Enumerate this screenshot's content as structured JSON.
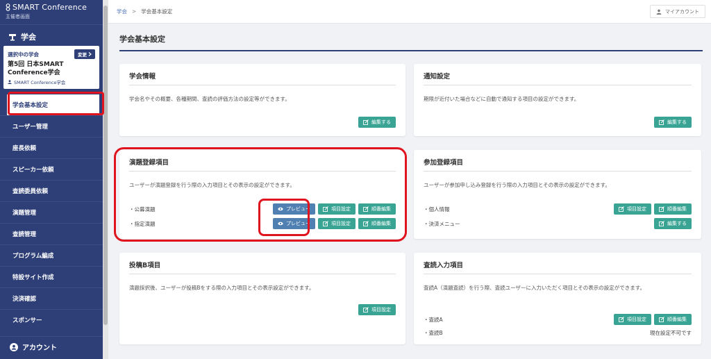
{
  "brand": {
    "name": "SMART Conference",
    "sub": "主催者画面"
  },
  "sidebar": {
    "section_label": "学会",
    "conference": {
      "selected_label": "選択中の学会",
      "change_label": "変更",
      "name": "第5回 日本SMART Conference学会",
      "org": "SMART Conference学会"
    },
    "items": [
      {
        "label": "学会基本設定"
      },
      {
        "label": "ユーザー管理"
      },
      {
        "label": "座長依頼"
      },
      {
        "label": "スピーカー依頼"
      },
      {
        "label": "査読委員依頼"
      },
      {
        "label": "演題管理"
      },
      {
        "label": "査読管理"
      },
      {
        "label": "プログラム編成"
      },
      {
        "label": "特設サイト作成"
      },
      {
        "label": "決済確認"
      },
      {
        "label": "スポンサー"
      }
    ],
    "account_label": "アカウント"
  },
  "topbar": {
    "breadcrumb_root": "学会",
    "breadcrumb_sep": ">",
    "breadcrumb_current": "学会基本設定",
    "my_account": "マイアカウント"
  },
  "page": {
    "title": "学会基本設定"
  },
  "cards": {
    "society_info": {
      "title": "学会情報",
      "desc": "学会名やその概要、各種期間、査読の評価方法の設定等ができます。",
      "edit": "編集する"
    },
    "notification": {
      "title": "通知設定",
      "desc": "期限が近付いた場合などに自動で通知する項目の設定ができます。",
      "edit": "編集する"
    },
    "abstract": {
      "title": "演題登録項目",
      "desc": "ユーザーが演題登録を行う際の入力項目とその表示の設定ができます。",
      "rows": [
        {
          "label": "・公募演題",
          "preview": "プレビュー",
          "items": "項目設定",
          "order": "順番編集"
        },
        {
          "label": "・指定演題",
          "preview": "プレビュー",
          "items": "項目設定",
          "order": "順番編集"
        }
      ]
    },
    "participation": {
      "title": "参加登録項目",
      "desc": "ユーザーが参加申し込み登録を行う際の入力項目とその表示の設定ができます。",
      "row1": {
        "label": "・個人情報",
        "items": "項目設定",
        "order": "順番編集"
      },
      "row2": {
        "label": "・決済メニュー",
        "edit": "編集する"
      }
    },
    "submission_b": {
      "title": "投稿B項目",
      "desc": "演題採択後、ユーザーが投稿Bをする際の入力項目とその表示設定ができます。",
      "items": "項目設定"
    },
    "review": {
      "title": "査読入力項目",
      "desc": "査読A（演題査読）を行う際、査読ユーザーに入力いただく項目とその表示の設定ができます。",
      "row1": {
        "label": "・査読A",
        "items": "項目設定",
        "order": "順番編集"
      },
      "row2": {
        "label": "・査読B",
        "note": "現在設定不可です"
      }
    }
  },
  "colors": {
    "sidebar": "#2e3f78",
    "accent_button": "#3aa494",
    "preview_button": "#4f80b1",
    "highlight": "#e0141e"
  }
}
